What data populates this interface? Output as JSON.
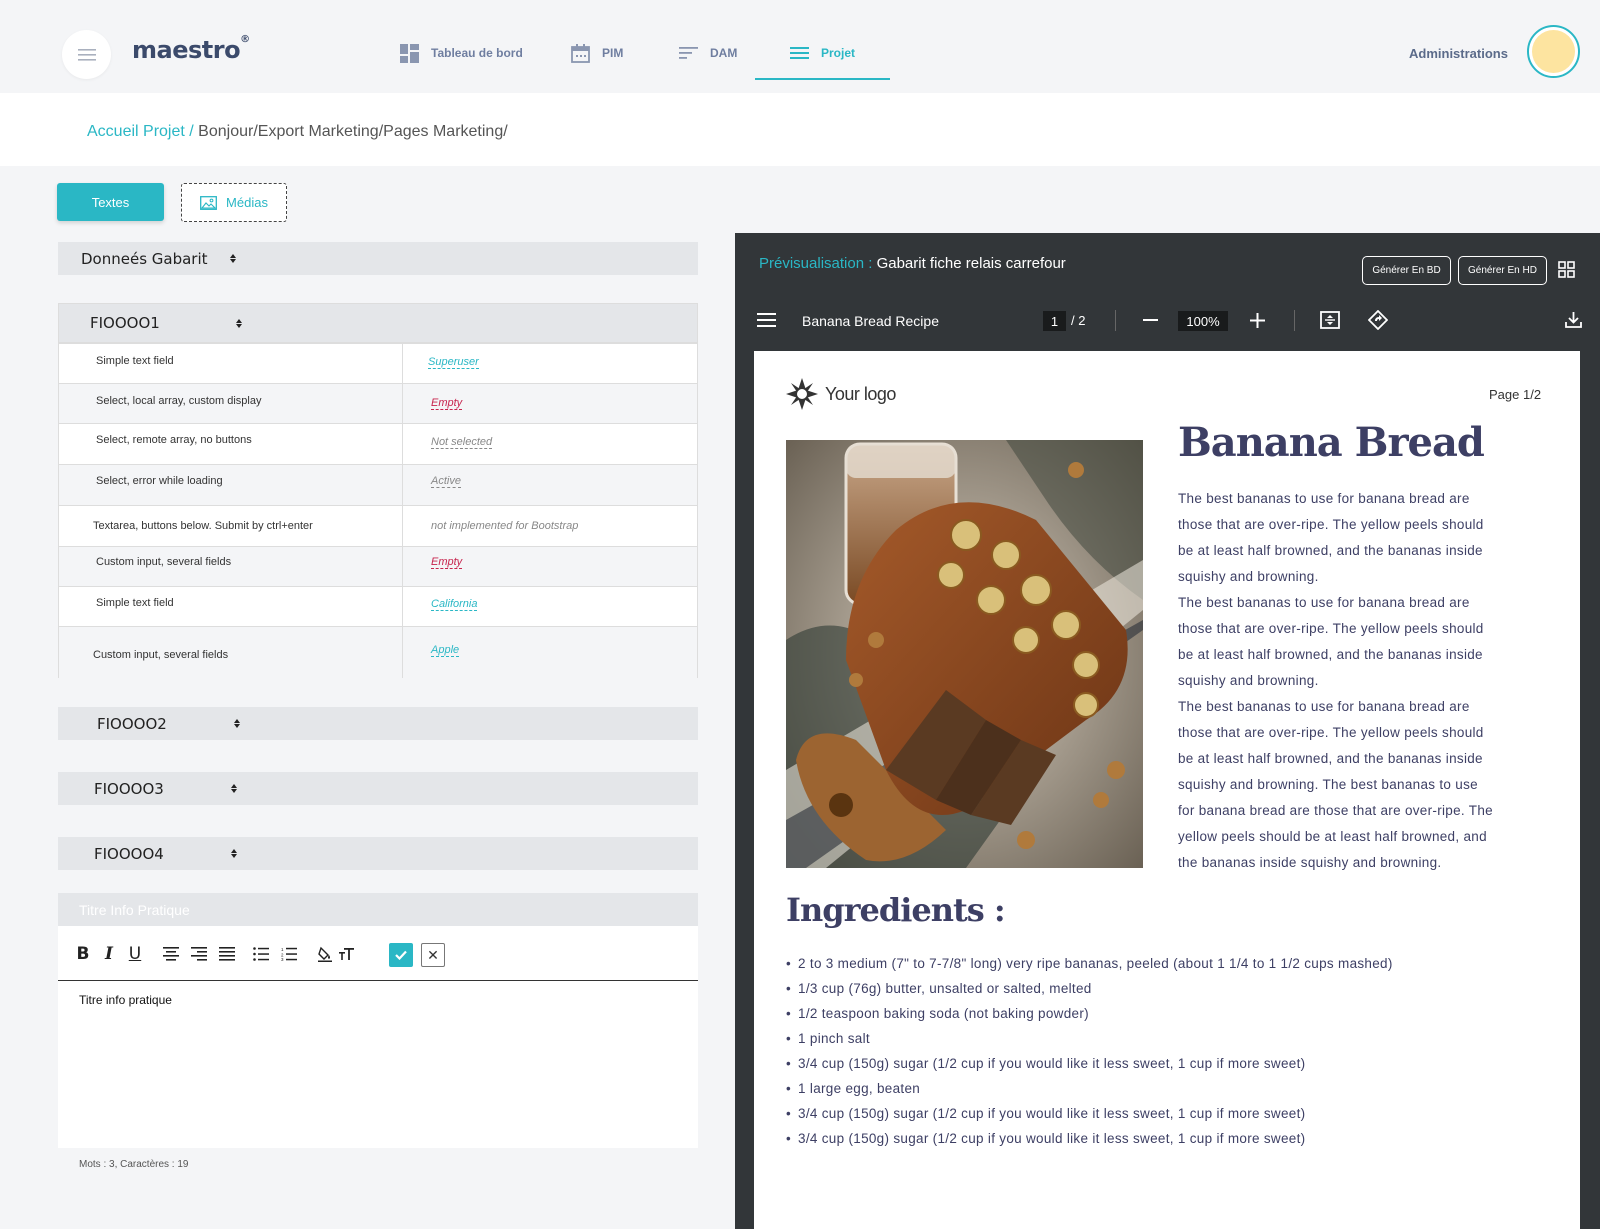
{
  "app": {
    "logo": "maestro",
    "logo_mark": "®"
  },
  "nav": {
    "items": [
      {
        "label": "Tableau de bord",
        "icon": "dashboard-icon"
      },
      {
        "label": "PIM",
        "icon": "calendar-icon"
      },
      {
        "label": "DAM",
        "icon": "lines-icon"
      },
      {
        "label": "Projet",
        "icon": "list-icon",
        "active": true
      }
    ],
    "admin": "Administrations"
  },
  "breadcrumb": {
    "root": "Accueil Projet /",
    "path": "Bonjour/Export Marketing/Pages Marketing/"
  },
  "tabs": {
    "textes": "Textes",
    "medias": "Médias"
  },
  "sections": {
    "gabarit": "Donneés Gabarit",
    "fi1": "FIOOOO1",
    "fi2": "FIOOOO2",
    "fi3": "FIOOOO3",
    "fi4": "FIOOOO4"
  },
  "fields": [
    {
      "label": "Simple text field",
      "value": "Superuser",
      "style": "blue"
    },
    {
      "label": "Select, local array, custom display",
      "value": "Empty",
      "style": "red"
    },
    {
      "label": "Select, remote array, no buttons",
      "value": "Not selected",
      "style": "grey"
    },
    {
      "label": "Select, error while loading",
      "value": "Active",
      "style": "grey"
    },
    {
      "label": "Textarea, buttons below. Submit by ctrl+enter",
      "value": "not implemented for Bootstrap",
      "style": "plain"
    },
    {
      "label": "Custom input, several fields",
      "value": "Empty",
      "style": "red"
    },
    {
      "label": "Simple text field",
      "value": "California",
      "style": "blue"
    },
    {
      "label": "Custom input, several fields",
      "value": "Apple",
      "style": "blue"
    }
  ],
  "editor": {
    "header": "Titre Info Pratique",
    "content": "Titre info pratique",
    "status": "Mots : 3, Caractères : 19",
    "toolbar": [
      "bold-icon",
      "italic-icon",
      "underline-icon",
      "align-left-icon",
      "align-right-icon",
      "justify-icon",
      "bullet-list-icon",
      "numbered-list-icon",
      "fill-color-icon",
      "text-size-icon",
      "confirm-icon",
      "cancel-icon"
    ]
  },
  "preview": {
    "label": "Prévisualisation :",
    "title": "Gabarit fiche relais carrefour",
    "btn_bd": "Générer En BD",
    "btn_hd": "Générer En HD",
    "pdf_name": "Banana Bread Recipe",
    "page_current": "1",
    "page_total": "/ 2",
    "zoom": "100%"
  },
  "doc": {
    "logo": "Your logo",
    "page": "Page 1/2",
    "title": "Banana Bread",
    "description": "The best bananas to use for banana bread are those that are over-ripe. The yellow peels should be at least half browned, and the bananas inside squishy and browning.\nThe best bananas to use for banana bread are those that are over-ripe. The yellow peels should be at least half browned, and the bananas inside squishy and browning.\nThe best bananas to use for banana bread are those that are over-ripe. The yellow peels should be at least half browned, and the bananas inside squishy and browning. The best bananas to use for banana bread are those that are over-ripe. The yellow peels should be at least half browned, and the bananas inside squishy and browning.",
    "ingredients_title": "Ingredients :",
    "ingredients": [
      "2 to 3 medium (7\" to 7-7/8\" long) very ripe bananas, peeled (about 1 1/4 to 1 1/2 cups mashed)",
      "1/3 cup (76g) butter, unsalted or salted, melted",
      "1/2 teaspoon baking soda (not baking powder)",
      "1 pinch salt",
      "3/4 cup (150g) sugar (1/2 cup if you would like it less sweet, 1 cup if more sweet)",
      "1 large egg, beaten",
      "3/4 cup (150g) sugar (1/2 cup if you would like it less sweet, 1 cup if more sweet)",
      "3/4 cup (150g) sugar (1/2 cup if you would like it less sweet, 1 cup if more sweet)"
    ]
  },
  "colors": {
    "accent": "#2ab7c5",
    "error": "#c7254e",
    "heading": "#3d3f64",
    "viewer": "#323639"
  }
}
